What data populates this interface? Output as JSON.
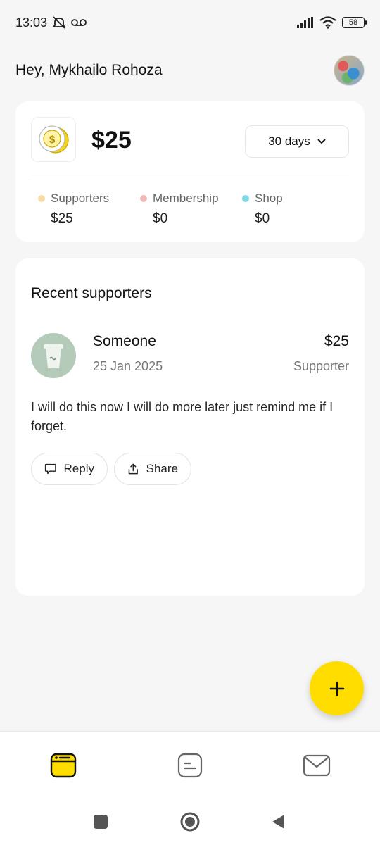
{
  "status_bar": {
    "time": "13:03",
    "battery": "58",
    "icons": [
      "mute-icon",
      "voicemail-icon",
      "signal-icon",
      "wifi-icon",
      "battery-icon"
    ]
  },
  "header": {
    "greeting": "Hey, Mykhailo Rohoza"
  },
  "earnings": {
    "total": "$25",
    "range_label": "30 days",
    "stats": [
      {
        "label": "Supporters",
        "value": "$25",
        "color": "#f7dca6"
      },
      {
        "label": "Membership",
        "value": "$0",
        "color": "#f2b8b5"
      },
      {
        "label": "Shop",
        "value": "$0",
        "color": "#7fd8e3"
      }
    ]
  },
  "recent": {
    "title": "Recent supporters",
    "supporter": {
      "name": "Someone",
      "date": "25 Jan 2025",
      "amount": "$25",
      "type": "Supporter",
      "message": "I will do this now I will do more later just remind me if I forget."
    },
    "actions": {
      "reply": "Reply",
      "share": "Share"
    }
  },
  "accent_color": "#ffdd00",
  "nav": [
    "dashboard-icon",
    "posts-icon",
    "messages-icon"
  ]
}
